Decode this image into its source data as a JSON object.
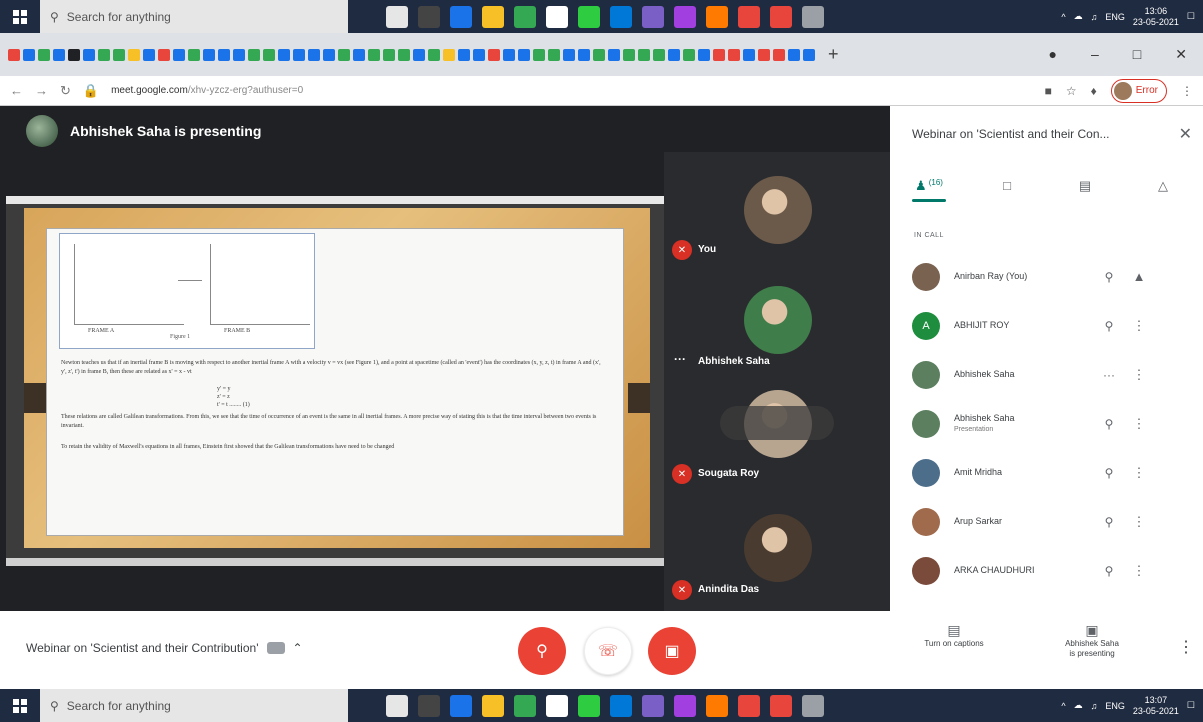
{
  "taskbar": {
    "search_placeholder": "Search for anything",
    "top_time": "13:06",
    "top_date": "23-05-2021",
    "bottom_time": "13:07",
    "bottom_date": "23-05-2021",
    "lang": "ENG",
    "app_colors": [
      "#e6e6e6",
      "#444",
      "#1a73e8",
      "#f6c026",
      "#34a853",
      "#fff",
      "#2ecc40",
      "#0078d7",
      "#7a5fc7",
      "#a23fe0",
      "#ff7a00",
      "#e8453c",
      "#e8453c",
      "#9aa0a6"
    ]
  },
  "browser": {
    "url_host": "meet.google.com",
    "url_path": "/xhv-yzcz-erg?authuser=0",
    "new_tab_label": "+",
    "profile_label": "Error",
    "favicon_colors": [
      "#e8453c",
      "#1a73e8",
      "#34a853",
      "#1a73e8",
      "#202124",
      "#1a73e8",
      "#34a853",
      "#34a853",
      "#f6c026",
      "#1a73e8",
      "#e8453c",
      "#1a73e8",
      "#34a853",
      "#1a73e8",
      "#1a73e8",
      "#1a73e8",
      "#34a853",
      "#34a853",
      "#1a73e8",
      "#1a73e8",
      "#1a73e8",
      "#1a73e8",
      "#34a853",
      "#1a73e8",
      "#34a853",
      "#34a853",
      "#34a853",
      "#1a73e8",
      "#34a853",
      "#f6c026",
      "#1a73e8",
      "#1a73e8",
      "#e8453c",
      "#1a73e8",
      "#1a73e8",
      "#34a853",
      "#34a853",
      "#1a73e8",
      "#1a73e8",
      "#34a853",
      "#1a73e8",
      "#34a853",
      "#34a853",
      "#34a853",
      "#1a73e8",
      "#34a853",
      "#1a73e8",
      "#e8453c",
      "#e8453c",
      "#1a73e8",
      "#e8453c",
      "#e8453c",
      "#1a73e8",
      "#1a73e8"
    ]
  },
  "presenter": {
    "banner": "Abhishek Saha is presenting"
  },
  "slide": {
    "frame_a": "FRAME A",
    "frame_b": "FRAME B",
    "figure_caption": "Figure 1",
    "paragraph_1": "Newton teaches us that if an inertial frame B is moving with respect to another inertial frame A with a velocity v = vx (see Figure 1), and a point at spacetime (called an 'event') has the coordinates (x, y, z, t) in frame A and (x', y', z', t') in frame B, then these are related as x' = x - vt",
    "eq_1": "y' = y",
    "eq_2": "z' = z",
    "eq_3": "t' = t ........ (1)",
    "paragraph_2": "These relations are called Galilean transformations. From this, we see that the time of occurrence of an event is the same in all inertial frames. A more precise way of stating this is that the time interval between two events is invariant.",
    "paragraph_3": "To retain the validity of Maxwell's equations in all frames, Einstein first showed that the Galilean transformations have need to be changed"
  },
  "tiles": [
    {
      "name": "You",
      "photo_color": "#6b5a4a"
    },
    {
      "name": "Abhishek Saha",
      "photo_color": "#3f7d4a"
    },
    {
      "name": "Sougata Roy",
      "photo_color": "#b7a58f"
    },
    {
      "name": "Anindita Das",
      "photo_color": "#4a3b30"
    }
  ],
  "panel": {
    "title": "Webinar on 'Scientist and their Con...",
    "people_count": "(16)",
    "section_label": "IN CALL",
    "participants": [
      {
        "name": "Anirban Ray (You)",
        "sub": "",
        "avatar_color": "#7a6250",
        "initial": ""
      },
      {
        "name": "ABHIJIT ROY",
        "sub": "",
        "avatar_color": "#1e8e3e",
        "initial": "A"
      },
      {
        "name": "Abhishek Saha",
        "sub": "",
        "avatar_color": "#5b7f5f",
        "initial": ""
      },
      {
        "name": "Abhishek Saha",
        "sub": "Presentation",
        "avatar_color": "#5b7f5f",
        "initial": ""
      },
      {
        "name": "Amit Mridha",
        "sub": "",
        "avatar_color": "#4d6e8a",
        "initial": ""
      },
      {
        "name": "Arup Sarkar",
        "sub": "",
        "avatar_color": "#a06a4d",
        "initial": ""
      },
      {
        "name": "ARKA CHAUDHURI",
        "sub": "",
        "avatar_color": "#7a4a3a",
        "initial": ""
      }
    ]
  },
  "bottom": {
    "meeting_title": "Webinar on 'Scientist and their Contribution'",
    "captions_label": "Turn on captions",
    "presenting_label_1": "Abhishek Saha",
    "presenting_label_2": "is presenting"
  }
}
